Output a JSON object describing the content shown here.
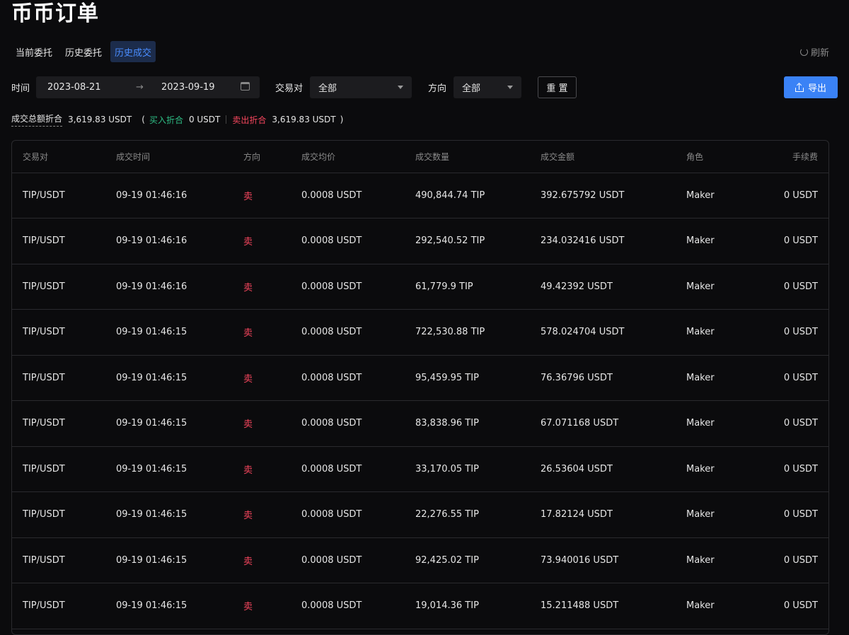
{
  "page": {
    "title": "币币订单"
  },
  "tabs": [
    {
      "label": "当前委托",
      "active": false
    },
    {
      "label": "历史委托",
      "active": false
    },
    {
      "label": "历史成交",
      "active": true
    }
  ],
  "refresh_label": "刷新",
  "filters": {
    "time_label": "时间",
    "date_start": "2023-08-21",
    "date_end": "2023-09-19",
    "pair_label": "交易对",
    "pair_value": "全部",
    "direction_label": "方向",
    "direction_value": "全部",
    "reset_label": "重 置",
    "export_label": "导出"
  },
  "summary": {
    "total_label": "成交总额折合",
    "total_value": "3,619.83 USDT",
    "open_paren": "(",
    "buy_label": "买入折合",
    "buy_value": "0 USDT",
    "sell_label": "卖出折合",
    "sell_value": "3,619.83 USDT",
    "close_paren": ")"
  },
  "colors": {
    "accent": "#3a82f6",
    "buy": "#2ebd85",
    "sell": "#f6465d",
    "background": "#0b0b0d"
  },
  "table": {
    "headers": [
      "交易对",
      "成交时间",
      "方向",
      "成交均价",
      "成交数量",
      "成交金额",
      "角色",
      "手续费"
    ],
    "rows": [
      [
        "TIP/USDT",
        "09-19 01:46:16",
        "卖",
        "0.0008 USDT",
        "490,844.74 TIP",
        "392.675792 USDT",
        "Maker",
        "0 USDT"
      ],
      [
        "TIP/USDT",
        "09-19 01:46:16",
        "卖",
        "0.0008 USDT",
        "292,540.52 TIP",
        "234.032416 USDT",
        "Maker",
        "0 USDT"
      ],
      [
        "TIP/USDT",
        "09-19 01:46:16",
        "卖",
        "0.0008 USDT",
        "61,779.9 TIP",
        "49.42392 USDT",
        "Maker",
        "0 USDT"
      ],
      [
        "TIP/USDT",
        "09-19 01:46:15",
        "卖",
        "0.0008 USDT",
        "722,530.88 TIP",
        "578.024704 USDT",
        "Maker",
        "0 USDT"
      ],
      [
        "TIP/USDT",
        "09-19 01:46:15",
        "卖",
        "0.0008 USDT",
        "95,459.95 TIP",
        "76.36796 USDT",
        "Maker",
        "0 USDT"
      ],
      [
        "TIP/USDT",
        "09-19 01:46:15",
        "卖",
        "0.0008 USDT",
        "83,838.96 TIP",
        "67.071168 USDT",
        "Maker",
        "0 USDT"
      ],
      [
        "TIP/USDT",
        "09-19 01:46:15",
        "卖",
        "0.0008 USDT",
        "33,170.05 TIP",
        "26.53604 USDT",
        "Maker",
        "0 USDT"
      ],
      [
        "TIP/USDT",
        "09-19 01:46:15",
        "卖",
        "0.0008 USDT",
        "22,276.55 TIP",
        "17.82124 USDT",
        "Maker",
        "0 USDT"
      ],
      [
        "TIP/USDT",
        "09-19 01:46:15",
        "卖",
        "0.0008 USDT",
        "92,425.02 TIP",
        "73.940016 USDT",
        "Maker",
        "0 USDT"
      ],
      [
        "TIP/USDT",
        "09-19 01:46:15",
        "卖",
        "0.0008 USDT",
        "19,014.36 TIP",
        "15.211488 USDT",
        "Maker",
        "0 USDT"
      ]
    ]
  }
}
